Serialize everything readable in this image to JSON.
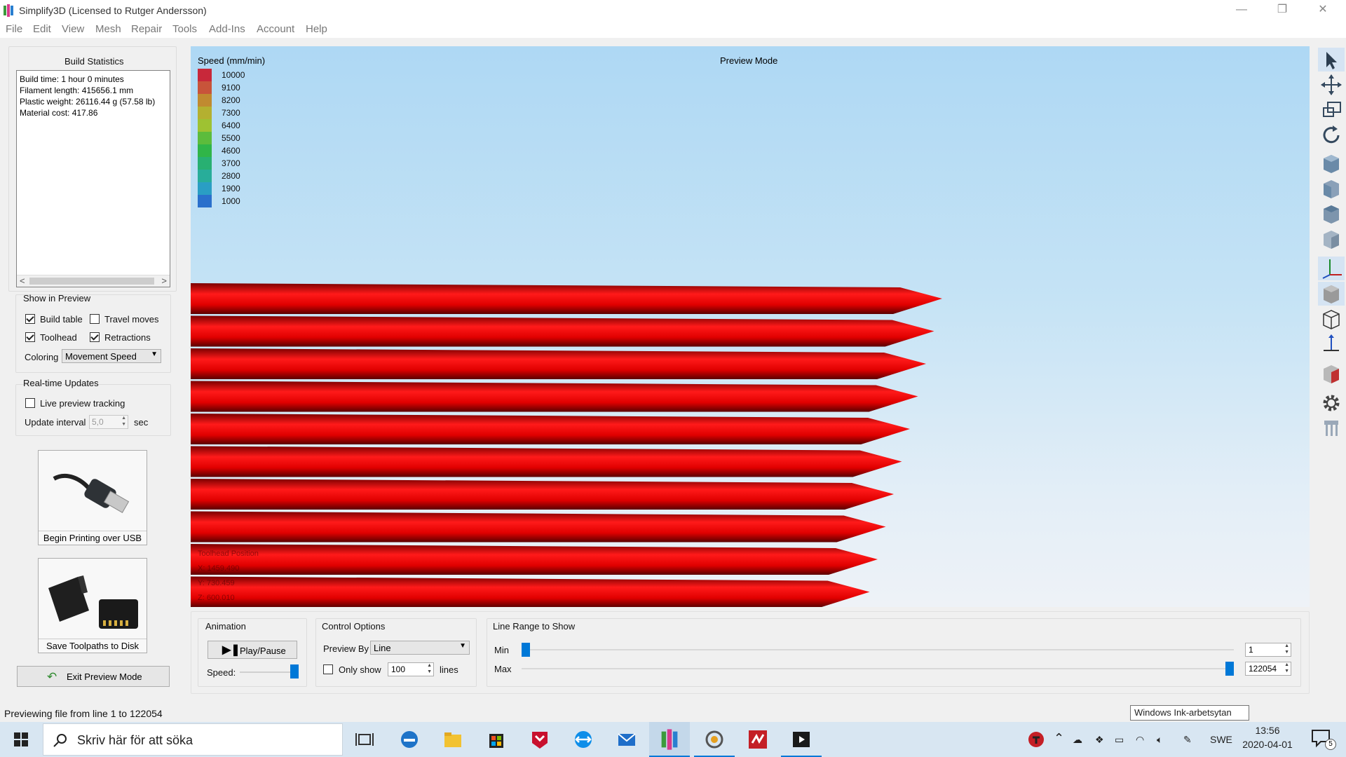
{
  "window": {
    "title": "Simplify3D (Licensed to Rutger Andersson)",
    "minimize_icon": "—",
    "restore_icon": "❐",
    "close_icon": "✕"
  },
  "menu": [
    "File",
    "Edit",
    "View",
    "Mesh",
    "Repair",
    "Tools",
    "Add-Ins",
    "Account",
    "Help"
  ],
  "build_stats": {
    "heading": "Build Statistics",
    "lines": [
      "Build time: 1 hour 0 minutes",
      "Filament length: 415656.1 mm",
      "Plastic weight: 26116.44 g (57.58 lb)",
      "Material cost: 417.86"
    ],
    "scroll_left": "<",
    "scroll_right": ">"
  },
  "show_in_preview": {
    "heading": "Show in Preview",
    "build_table": {
      "label": "Build table",
      "checked": true
    },
    "travel_moves": {
      "label": "Travel moves",
      "checked": false
    },
    "toolhead": {
      "label": "Toolhead",
      "checked": true
    },
    "retractions": {
      "label": "Retractions",
      "checked": true
    },
    "coloring_label": "Coloring",
    "coloring_value": "Movement Speed"
  },
  "realtime": {
    "heading": "Real-time Updates",
    "live_tracking": {
      "label": "Live preview tracking",
      "checked": false
    },
    "interval_label": "Update interval",
    "interval_value": "5,0",
    "interval_unit": "sec"
  },
  "actions": {
    "usb_label": "Begin Printing over USB",
    "disk_label": "Save Toolpaths to Disk",
    "exit_label": "Exit Preview Mode"
  },
  "viewport": {
    "mode_label": "Preview Mode",
    "legend_title": "Speed (mm/min)",
    "legend": [
      {
        "value": "10000",
        "color": "#c8283a"
      },
      {
        "value": "9100",
        "color": "#c8543a"
      },
      {
        "value": "8200",
        "color": "#c08a30"
      },
      {
        "value": "7300",
        "color": "#b4b030"
      },
      {
        "value": "6400",
        "color": "#9ec232"
      },
      {
        "value": "5500",
        "color": "#5cbc3c"
      },
      {
        "value": "4600",
        "color": "#30b548"
      },
      {
        "value": "3700",
        "color": "#28b072"
      },
      {
        "value": "2800",
        "color": "#28ad9a"
      },
      {
        "value": "1900",
        "color": "#2a9ec4"
      },
      {
        "value": "1000",
        "color": "#2a70cc"
      }
    ],
    "toolhead": {
      "heading": "Toolhead Position",
      "x": "X: 1459.490",
      "y": "Y: 730.459",
      "z": "Z: 600.010"
    }
  },
  "animation": {
    "heading": "Animation",
    "play_label": "Play/Pause",
    "speed_label": "Speed:",
    "speed_level": 1.0
  },
  "control": {
    "heading": "Control Options",
    "preview_by_label": "Preview By",
    "preview_by_value": "Line",
    "only_show_label": "Only show",
    "only_show_value": "100",
    "lines_label": "lines"
  },
  "line_range": {
    "heading": "Line Range to Show",
    "min_label": "Min",
    "max_label": "Max",
    "min_value": "1",
    "max_value": "122054",
    "min_fraction": 0.0,
    "max_fraction": 1.0
  },
  "status": {
    "text": "Previewing file from line 1 to 122054",
    "tooltip": "Windows Ink-arbetsytan"
  },
  "taskbar": {
    "search_placeholder": "Skriv här för att söka",
    "language": "SWE",
    "time": "13:56",
    "date": "2020-04-01",
    "notifications": "5"
  }
}
